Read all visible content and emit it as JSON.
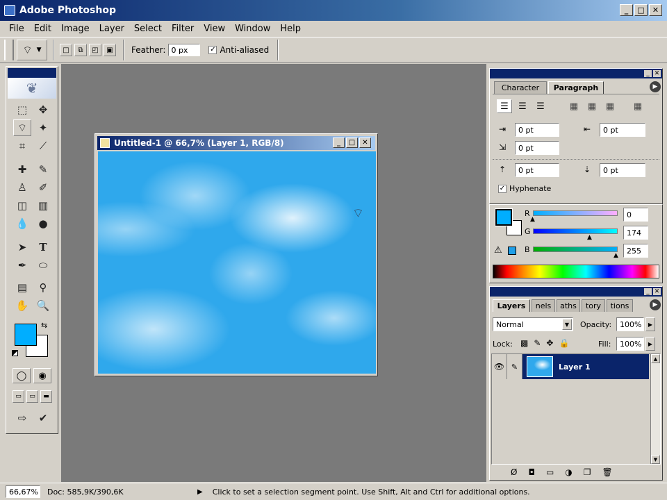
{
  "app": {
    "title": "Adobe Photoshop"
  },
  "menu": [
    "File",
    "Edit",
    "Image",
    "Layer",
    "Select",
    "Filter",
    "View",
    "Window",
    "Help"
  ],
  "options": {
    "feather_label": "Feather:",
    "feather_value": "0 px",
    "antialiased_label": "Anti-aliased",
    "antialiased_checked": true
  },
  "document": {
    "title": "Untitled-1 @ 66,7% (Layer 1, RGB/8)"
  },
  "paragraph_panel": {
    "tabs": [
      "Character",
      "Paragraph"
    ],
    "active_tab": "Paragraph",
    "left_indent": "0 pt",
    "right_indent": "0 pt",
    "first_line_indent": "0 pt",
    "space_before": "0 pt",
    "space_after": "0 pt",
    "hyphenate_label": "Hyphenate",
    "hyphenate_checked": true
  },
  "color_panel": {
    "r_label": "R",
    "r_value": "0",
    "g_label": "G",
    "g_value": "174",
    "b_label": "B",
    "b_value": "255",
    "foreground": "#00aeff",
    "background": "#ffffff"
  },
  "layers_panel": {
    "tabs": [
      "Layers",
      "nels",
      "aths",
      "tory",
      "tions"
    ],
    "blend_mode": "Normal",
    "opacity_label": "Opacity:",
    "opacity_value": "100%",
    "lock_label": "Lock:",
    "fill_label": "Fill:",
    "fill_value": "100%",
    "layers": [
      {
        "name": "Layer 1",
        "selected": true
      }
    ]
  },
  "status": {
    "zoom": "66,67%",
    "doc": "Doc: 585,9K/390,6K",
    "hint": "Click to set a selection segment point.  Use Shift, Alt and Ctrl for additional options."
  },
  "colors": {
    "title_blue": "#0a246a",
    "fg_swatch": "#00aeff",
    "selection": "#0a246a"
  }
}
